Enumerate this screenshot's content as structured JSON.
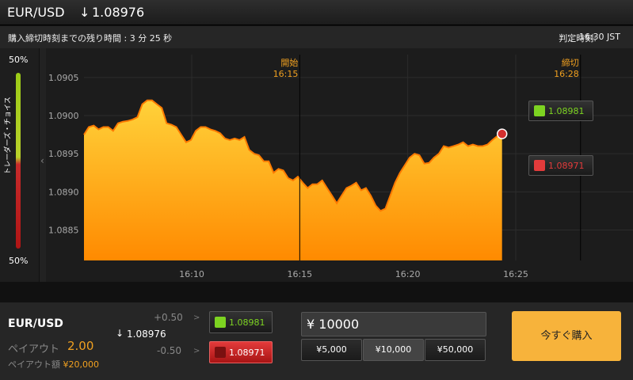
{
  "header": {
    "pair": "EUR/USD",
    "arrow": "↓",
    "price": "1.08976"
  },
  "infobar": {
    "left_text": "購入締切時刻までの残り時間 : 3 分 25 秒",
    "right_label": "判定時刻:",
    "right_time": "16:30 JST"
  },
  "sentiment": {
    "top_pct": "50%",
    "bottom_pct": "50%",
    "label": "トレーダーズ・チョイス",
    "collapse_icon": "‹"
  },
  "chart_data": {
    "type": "area",
    "series": [
      {
        "values": [
          1.08975,
          1.08985,
          1.08987,
          1.08982,
          1.08985,
          1.08985,
          1.0898,
          1.0899,
          1.08992,
          1.08993,
          1.08995,
          1.08998,
          1.09015,
          1.0902,
          1.0902,
          1.09015,
          1.0901,
          1.0899,
          1.08988,
          1.08985,
          1.08975,
          1.08965,
          1.08968,
          1.0898,
          1.08985,
          1.08985,
          1.08982,
          1.0898,
          1.08977,
          1.0897,
          1.08968,
          1.0897,
          1.08968,
          1.08972,
          1.08955,
          1.0895,
          1.08948,
          1.0894,
          1.0894,
          1.08925,
          1.0893,
          1.08928,
          1.08918,
          1.08915,
          1.0892,
          1.08912,
          1.08905,
          1.0891,
          1.0891,
          1.08915,
          1.08905,
          1.08895,
          1.08885,
          1.08895,
          1.08905,
          1.08908,
          1.08912,
          1.08902,
          1.08905,
          1.08895,
          1.08882,
          1.08875,
          1.08878,
          1.08895,
          1.08912,
          1.08925,
          1.08935,
          1.08945,
          1.0895,
          1.08948,
          1.08937,
          1.08938,
          1.08945,
          1.0895,
          1.0896,
          1.08958,
          1.0896,
          1.08962,
          1.08965,
          1.0896,
          1.08962,
          1.0896,
          1.0896,
          1.08962,
          1.08968,
          1.08973,
          1.08976
        ]
      }
    ],
    "y_ticks": [
      "1.0905",
      "1.0900",
      "1.0895",
      "1.0890",
      "1.0885"
    ],
    "x_ticks": [
      "16:10",
      "16:15",
      "16:20",
      "16:25"
    ],
    "ylim": [
      1.0881,
      1.0908
    ],
    "markers": [
      {
        "label": "開始",
        "time": "16:15"
      },
      {
        "label": "締切",
        "time": "16:28"
      }
    ],
    "high_tag": {
      "value": "1.08981",
      "color": "#7dd321"
    },
    "low_tag": {
      "value": "1.08971",
      "color": "#e33b3b"
    }
  },
  "trade": {
    "pair": "EUR/USD",
    "payout_label": "ペイアウト",
    "payout_value": "2.00",
    "amount_label": "ペイアウト額",
    "amount_value": "¥20,000",
    "arrow": "↓",
    "current_price": "1.08976",
    "up_offset": "+0.50",
    "down_offset": "-0.50",
    "gt": ">",
    "high_price": "1.08981",
    "low_price": "1.08971",
    "input_value": "¥ 10000",
    "presets": [
      "¥5,000",
      "¥10,000",
      "¥50,000"
    ],
    "buy_label": "今すぐ購入"
  },
  "colors": {
    "accent": "#f7b33b",
    "up": "#7dd321",
    "down": "#e33b3b"
  }
}
